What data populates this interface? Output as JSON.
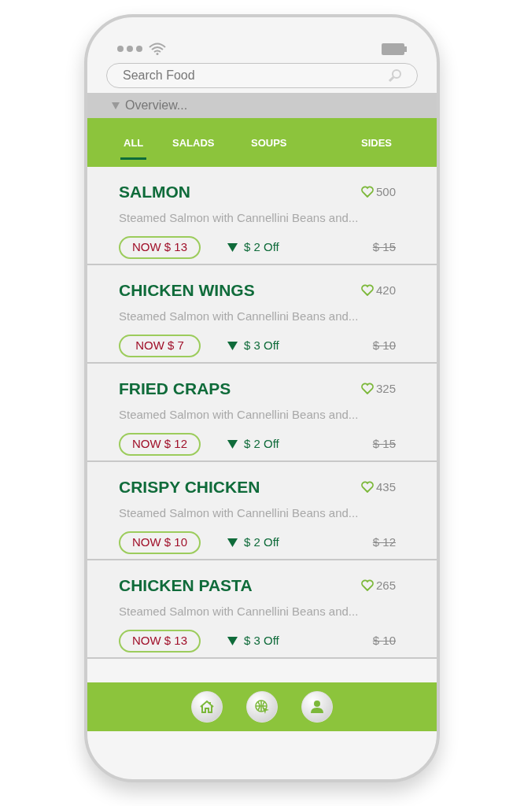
{
  "search": {
    "placeholder": "Search Food"
  },
  "overview": {
    "label": "Overview...",
    "expanded": true
  },
  "tabs": [
    {
      "label": "ALL",
      "selected": true
    },
    {
      "label": "SALADS",
      "selected": false
    },
    {
      "label": "SOUPS",
      "selected": false
    },
    {
      "label": "SIDES",
      "selected": false
    }
  ],
  "items": [
    {
      "name": "SALMON",
      "likes": "500",
      "description": "Steamed Salmon with Cannellini Beans and...",
      "now": "NOW $ 13",
      "off": "$ 2 Off",
      "old": "$ 15"
    },
    {
      "name": "CHICKEN WINGS",
      "likes": "420",
      "description": "Steamed Salmon with Cannellini Beans and...",
      "now": "NOW $ 7",
      "off": "$ 3 Off",
      "old": "$ 10"
    },
    {
      "name": "FRIED CRAPS",
      "likes": "325",
      "description": "Steamed Salmon with Cannellini Beans and...",
      "now": "NOW $ 12",
      "off": "$ 2 Off",
      "old": "$ 15"
    },
    {
      "name": "CRISPY CHICKEN",
      "likes": "435",
      "description": "Steamed Salmon with Cannellini Beans and...",
      "now": "NOW $ 10",
      "off": "$ 2 Off",
      "old": "$ 12"
    },
    {
      "name": "CHICKEN PASTA",
      "likes": "265",
      "description": "Steamed Salmon with Cannellini Beans and...",
      "now": "NOW $ 13",
      "off": "$ 3 Off",
      "old": "$ 10"
    }
  ],
  "nav": [
    {
      "kind": "home"
    },
    {
      "kind": "web"
    },
    {
      "kind": "profile"
    }
  ]
}
